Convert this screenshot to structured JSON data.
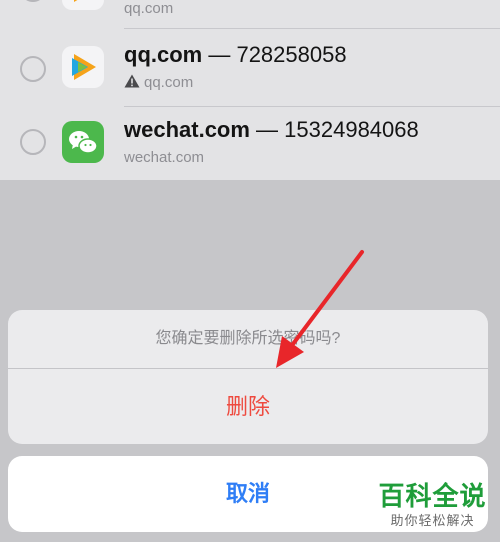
{
  "password_list": {
    "items": [
      {
        "title_domain": "",
        "title_account": "",
        "subtitle": "qq.com",
        "has_warning": false,
        "icon": "tencent-video-icon"
      },
      {
        "title_domain": "qq.com",
        "title_account": " — 728258058",
        "subtitle": "qq.com",
        "has_warning": true,
        "icon": "tencent-video-icon"
      },
      {
        "title_domain": "wechat.com",
        "title_account": " — 15324984068",
        "subtitle": "wechat.com",
        "has_warning": false,
        "icon": "wechat-icon"
      }
    ]
  },
  "action_sheet": {
    "message": "您确定要删除所选密码吗?",
    "delete_label": "删除",
    "cancel_label": "取消"
  },
  "watermark": {
    "title": "百科全说",
    "subtitle": "助你轻松解决"
  },
  "colors": {
    "destructive": "#ee4a3f",
    "accent": "#2f7ef6",
    "watermark_green": "#1f9d3a",
    "arrow": "#e8262a"
  }
}
